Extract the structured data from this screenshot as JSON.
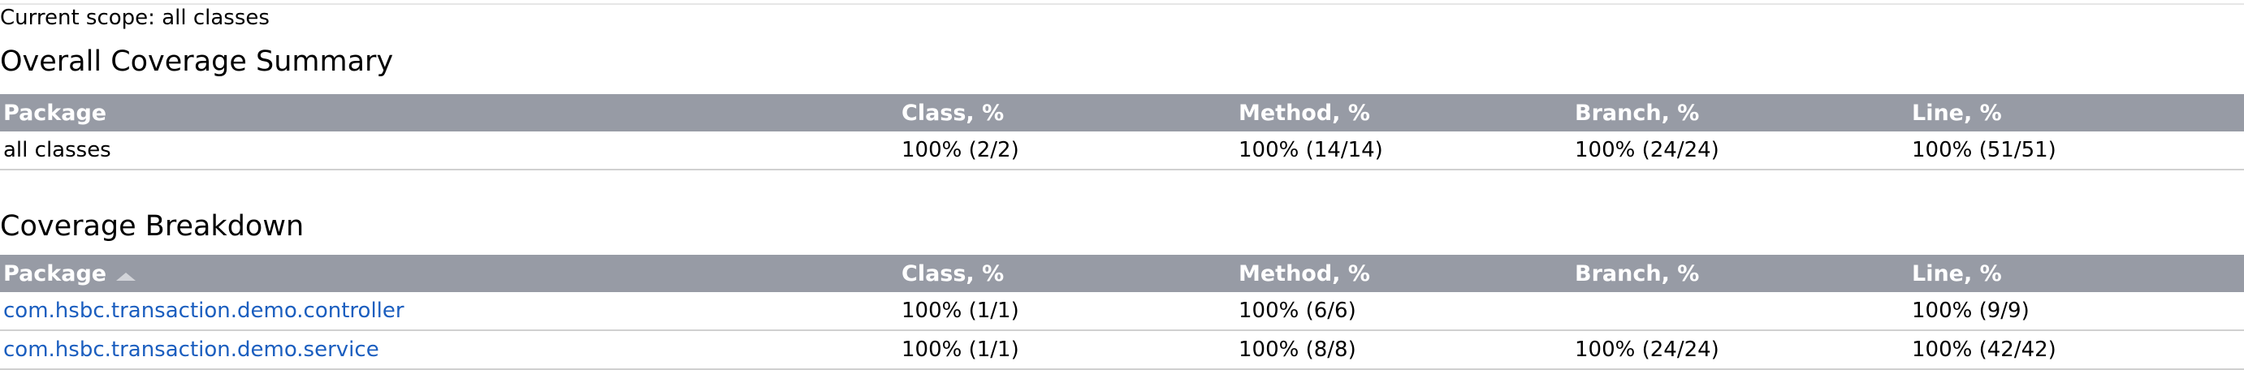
{
  "scope": {
    "text": "Current scope: all classes"
  },
  "summary": {
    "title": "Overall Coverage Summary",
    "headers": [
      "Package",
      "Class, %",
      "Method, %",
      "Branch, %",
      "Line, %"
    ],
    "rows": [
      {
        "package": "all classes",
        "class": "100% (2/2)",
        "method": "100% (14/14)",
        "branch": "100% (24/24)",
        "line": "100% (51/51)"
      }
    ]
  },
  "breakdown": {
    "title": "Coverage Breakdown",
    "headers": [
      "Package",
      "Class, %",
      "Method, %",
      "Branch, %",
      "Line, %"
    ],
    "sort_icon": "sort-ascending-icon",
    "rows": [
      {
        "package": "com.hsbc.transaction.demo.controller",
        "class": "100% (1/1)",
        "method": "100% (6/6)",
        "branch": "",
        "line": "100% (9/9)"
      },
      {
        "package": "com.hsbc.transaction.demo.service",
        "class": "100% (1/1)",
        "method": "100% (8/8)",
        "branch": "100% (24/24)",
        "line": "100% (42/42)"
      }
    ]
  },
  "colors": {
    "header_bg": "#979ba5",
    "header_text": "#ffffff",
    "link": "#1b5ebf",
    "row_divider": "#d0d0d0"
  }
}
